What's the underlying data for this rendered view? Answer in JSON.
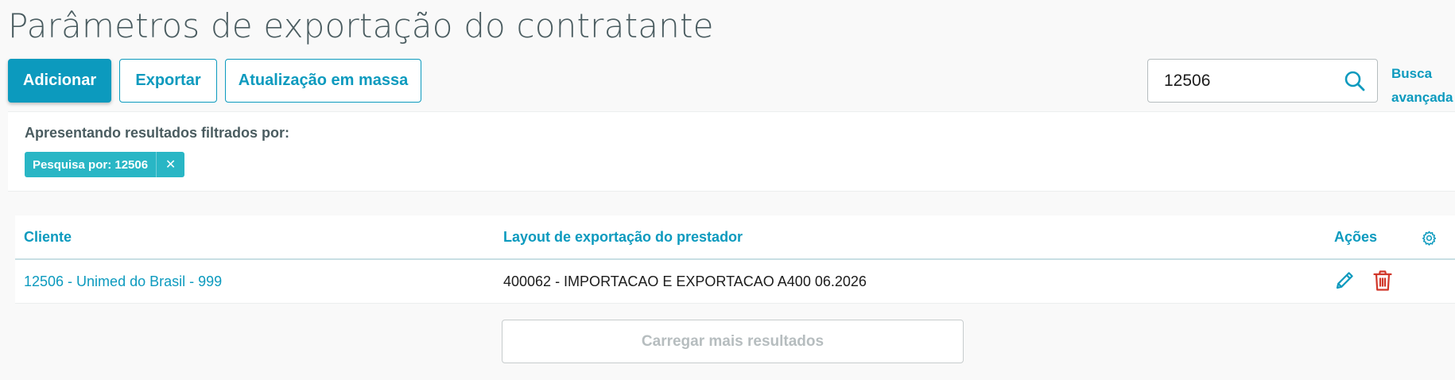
{
  "header": {
    "title": "Parâmetros de exportação do contratante"
  },
  "toolbar": {
    "add_label": "Adicionar",
    "export_label": "Exportar",
    "mass_update_label": "Atualização em massa"
  },
  "search": {
    "value": "12506",
    "advanced_line1": "Busca",
    "advanced_line2": "avançada"
  },
  "filters": {
    "label": "Apresentando resultados filtrados por:",
    "tags": [
      {
        "label": "Pesquisa por: 12506",
        "close": "✕"
      }
    ]
  },
  "table": {
    "columns": {
      "client": "Cliente",
      "layout": "Layout de exportação do prestador",
      "actions": "Ações"
    },
    "rows": [
      {
        "client": "12506 - Unimed do Brasil - 999",
        "layout": "400062 - IMPORTACAO E EXPORTACAO A400 06.2026"
      }
    ]
  },
  "load_more_label": "Carregar mais resultados",
  "colors": {
    "primary": "#0c9abe",
    "tag": "#29b6c5",
    "danger": "#d1372a",
    "title": "#4a5c60"
  },
  "icons": [
    "search-icon",
    "close-icon",
    "gear-icon",
    "edit-icon",
    "delete-icon"
  ]
}
